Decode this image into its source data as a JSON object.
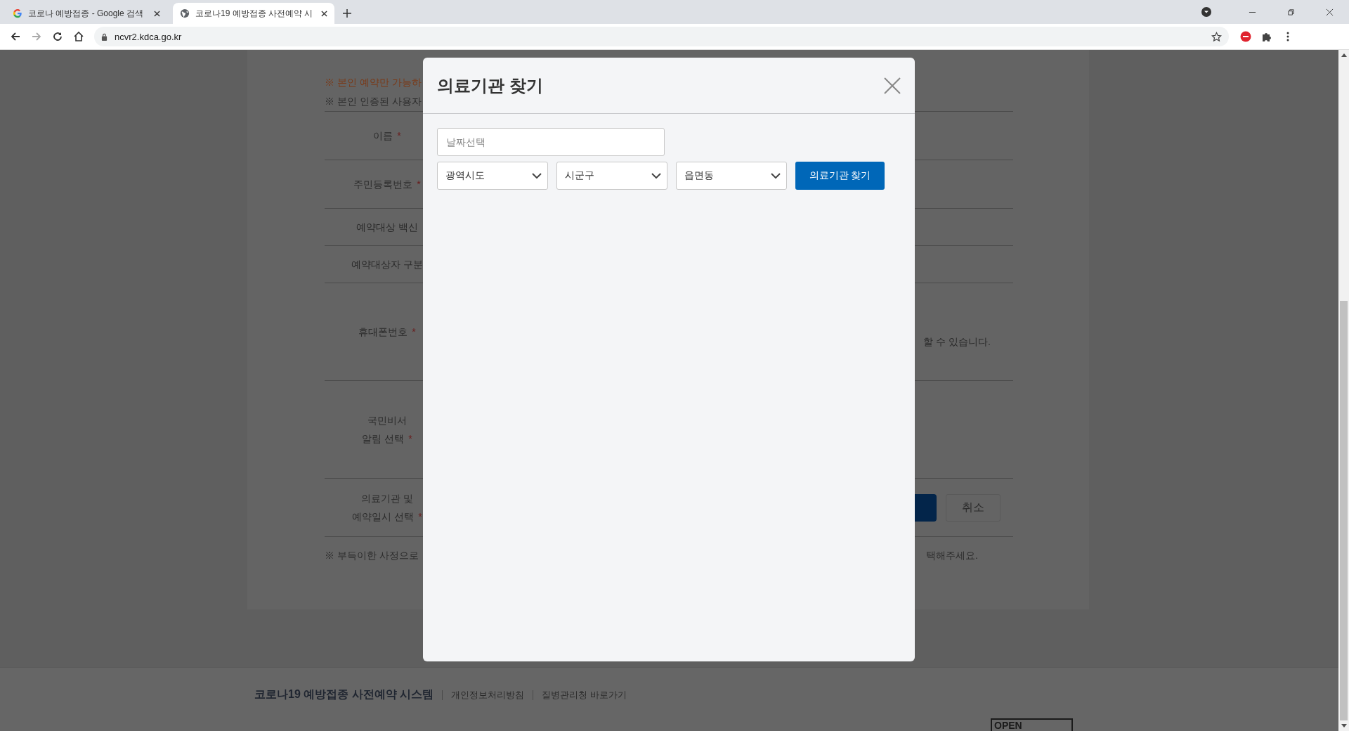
{
  "browser": {
    "tabs": [
      {
        "title": "코로나 예방접종 - Google 검색",
        "selected": false
      },
      {
        "title": "코로나19 예방접종 사전예약 시",
        "selected": true
      }
    ],
    "address": "ncvr2.kdca.go.kr"
  },
  "page": {
    "notes": [
      {
        "text": "※ 본인 예약만 가능하",
        "kind": "warning"
      },
      {
        "text": "※ 본인 인증된 사용자",
        "kind": "info"
      }
    ],
    "form_rows": [
      {
        "label": [
          "이름"
        ],
        "required_mark": "*"
      },
      {
        "label": [
          "주민등록번호"
        ],
        "required_mark": "*"
      },
      {
        "label": [
          "예약대상 백신"
        ]
      },
      {
        "label": [
          "예약대상자 구분"
        ]
      },
      {
        "label": [
          "휴대폰번호"
        ],
        "required_mark": "*",
        "hint": "할 수 있습니다."
      },
      {
        "label": [
          "국민비서",
          "알림 선택"
        ],
        "required_mark": "*"
      },
      {
        "label": [
          "의료기관 및",
          "예약일시 선택"
        ],
        "required_mark": "*",
        "primary_button": true,
        "cancel": "취소"
      }
    ],
    "bottom_note": {
      "left": "※ 부득이한 사정으로",
      "right": "택해주세요."
    }
  },
  "modal": {
    "title": "의료기관 찾기",
    "date_field": {
      "placeholder": "날짜선택"
    },
    "selects": [
      {
        "placeholder": "광역시도"
      },
      {
        "placeholder": "시군구"
      },
      {
        "placeholder": "읍면동"
      }
    ],
    "search_button": "의료기관 찾기"
  },
  "footer": {
    "title": "코로나19 예방접종 사전예약 시스템",
    "links": [
      "개인정보처리방침",
      "질병관리청 바로가기"
    ],
    "badge": "OPEN"
  }
}
